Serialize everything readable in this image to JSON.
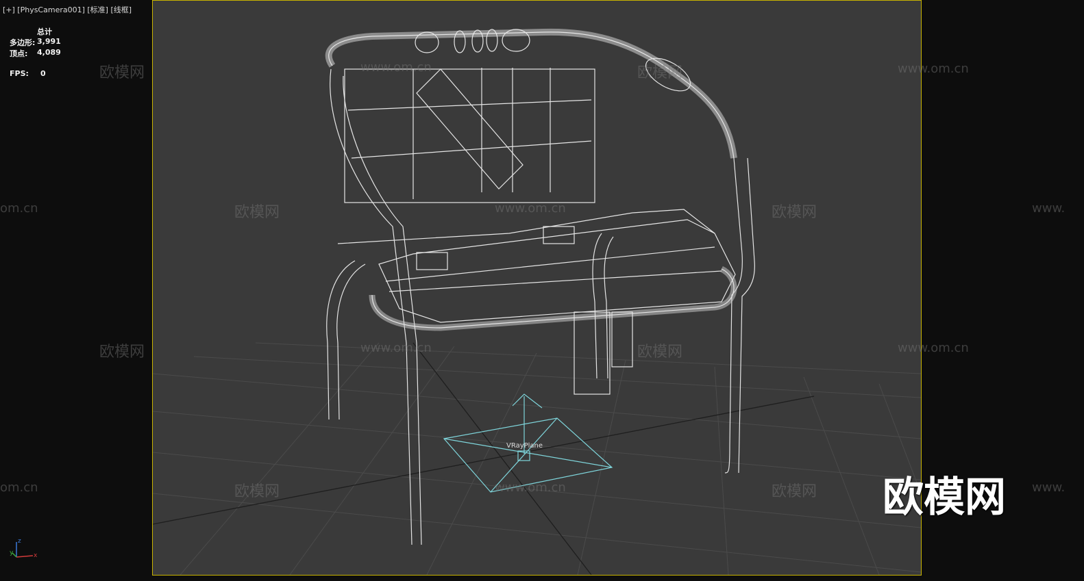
{
  "viewport": {
    "label": "[+] [PhysCamera001] [标准] [线框]",
    "object_label": "VRayPlane"
  },
  "stats": {
    "header": "总计",
    "polys_label": "多边形:",
    "polys_value": "3,991",
    "verts_label": "顶点:",
    "verts_value": "4,089",
    "fps_label": "FPS:",
    "fps_value": "0"
  },
  "axes": {
    "z": "z",
    "x": "x",
    "y": "y"
  },
  "watermarks": {
    "site_cn": "欧模网",
    "site_url": "www.om.cn",
    "site_url_short": "om.cn",
    "site_url_cut": "www.",
    "logo": "欧模网"
  },
  "colors": {
    "viewport_bg": "#3a3a3a",
    "grid": "#4a4a4a",
    "wireframe": "#e6e6e6",
    "vray_plane": "#7fd6dc",
    "border": "#c8b400"
  }
}
